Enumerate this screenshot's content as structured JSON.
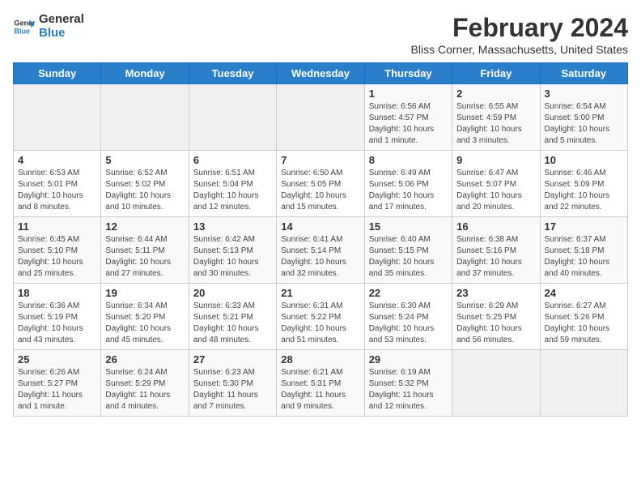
{
  "logo": {
    "line1": "General",
    "line2": "Blue"
  },
  "title": "February 2024",
  "subtitle": "Bliss Corner, Massachusetts, United States",
  "weekdays": [
    "Sunday",
    "Monday",
    "Tuesday",
    "Wednesday",
    "Thursday",
    "Friday",
    "Saturday"
  ],
  "weeks": [
    [
      {
        "day": "",
        "detail": ""
      },
      {
        "day": "",
        "detail": ""
      },
      {
        "day": "",
        "detail": ""
      },
      {
        "day": "",
        "detail": ""
      },
      {
        "day": "1",
        "detail": "Sunrise: 6:56 AM\nSunset: 4:57 PM\nDaylight: 10 hours\nand 1 minute."
      },
      {
        "day": "2",
        "detail": "Sunrise: 6:55 AM\nSunset: 4:59 PM\nDaylight: 10 hours\nand 3 minutes."
      },
      {
        "day": "3",
        "detail": "Sunrise: 6:54 AM\nSunset: 5:00 PM\nDaylight: 10 hours\nand 5 minutes."
      }
    ],
    [
      {
        "day": "4",
        "detail": "Sunrise: 6:53 AM\nSunset: 5:01 PM\nDaylight: 10 hours\nand 8 minutes."
      },
      {
        "day": "5",
        "detail": "Sunrise: 6:52 AM\nSunset: 5:02 PM\nDaylight: 10 hours\nand 10 minutes."
      },
      {
        "day": "6",
        "detail": "Sunrise: 6:51 AM\nSunset: 5:04 PM\nDaylight: 10 hours\nand 12 minutes."
      },
      {
        "day": "7",
        "detail": "Sunrise: 6:50 AM\nSunset: 5:05 PM\nDaylight: 10 hours\nand 15 minutes."
      },
      {
        "day": "8",
        "detail": "Sunrise: 6:49 AM\nSunset: 5:06 PM\nDaylight: 10 hours\nand 17 minutes."
      },
      {
        "day": "9",
        "detail": "Sunrise: 6:47 AM\nSunset: 5:07 PM\nDaylight: 10 hours\nand 20 minutes."
      },
      {
        "day": "10",
        "detail": "Sunrise: 6:46 AM\nSunset: 5:09 PM\nDaylight: 10 hours\nand 22 minutes."
      }
    ],
    [
      {
        "day": "11",
        "detail": "Sunrise: 6:45 AM\nSunset: 5:10 PM\nDaylight: 10 hours\nand 25 minutes."
      },
      {
        "day": "12",
        "detail": "Sunrise: 6:44 AM\nSunset: 5:11 PM\nDaylight: 10 hours\nand 27 minutes."
      },
      {
        "day": "13",
        "detail": "Sunrise: 6:42 AM\nSunset: 5:13 PM\nDaylight: 10 hours\nand 30 minutes."
      },
      {
        "day": "14",
        "detail": "Sunrise: 6:41 AM\nSunset: 5:14 PM\nDaylight: 10 hours\nand 32 minutes."
      },
      {
        "day": "15",
        "detail": "Sunrise: 6:40 AM\nSunset: 5:15 PM\nDaylight: 10 hours\nand 35 minutes."
      },
      {
        "day": "16",
        "detail": "Sunrise: 6:38 AM\nSunset: 5:16 PM\nDaylight: 10 hours\nand 37 minutes."
      },
      {
        "day": "17",
        "detail": "Sunrise: 6:37 AM\nSunset: 5:18 PM\nDaylight: 10 hours\nand 40 minutes."
      }
    ],
    [
      {
        "day": "18",
        "detail": "Sunrise: 6:36 AM\nSunset: 5:19 PM\nDaylight: 10 hours\nand 43 minutes."
      },
      {
        "day": "19",
        "detail": "Sunrise: 6:34 AM\nSunset: 5:20 PM\nDaylight: 10 hours\nand 45 minutes."
      },
      {
        "day": "20",
        "detail": "Sunrise: 6:33 AM\nSunset: 5:21 PM\nDaylight: 10 hours\nand 48 minutes."
      },
      {
        "day": "21",
        "detail": "Sunrise: 6:31 AM\nSunset: 5:22 PM\nDaylight: 10 hours\nand 51 minutes."
      },
      {
        "day": "22",
        "detail": "Sunrise: 6:30 AM\nSunset: 5:24 PM\nDaylight: 10 hours\nand 53 minutes."
      },
      {
        "day": "23",
        "detail": "Sunrise: 6:29 AM\nSunset: 5:25 PM\nDaylight: 10 hours\nand 56 minutes."
      },
      {
        "day": "24",
        "detail": "Sunrise: 6:27 AM\nSunset: 5:26 PM\nDaylight: 10 hours\nand 59 minutes."
      }
    ],
    [
      {
        "day": "25",
        "detail": "Sunrise: 6:26 AM\nSunset: 5:27 PM\nDaylight: 11 hours\nand 1 minute."
      },
      {
        "day": "26",
        "detail": "Sunrise: 6:24 AM\nSunset: 5:29 PM\nDaylight: 11 hours\nand 4 minutes."
      },
      {
        "day": "27",
        "detail": "Sunrise: 6:23 AM\nSunset: 5:30 PM\nDaylight: 11 hours\nand 7 minutes."
      },
      {
        "day": "28",
        "detail": "Sunrise: 6:21 AM\nSunset: 5:31 PM\nDaylight: 11 hours\nand 9 minutes."
      },
      {
        "day": "29",
        "detail": "Sunrise: 6:19 AM\nSunset: 5:32 PM\nDaylight: 11 hours\nand 12 minutes."
      },
      {
        "day": "",
        "detail": ""
      },
      {
        "day": "",
        "detail": ""
      }
    ]
  ]
}
